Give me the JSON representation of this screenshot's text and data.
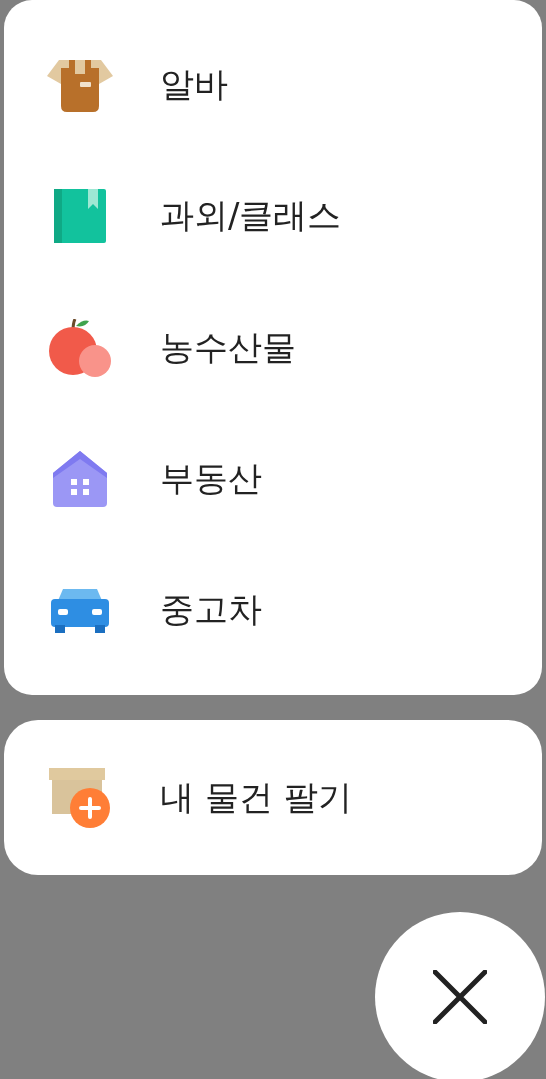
{
  "menu": {
    "items": [
      {
        "label": "알바"
      },
      {
        "label": "과외/클래스"
      },
      {
        "label": "농수산물"
      },
      {
        "label": "부동산"
      },
      {
        "label": "중고차"
      }
    ]
  },
  "sell": {
    "label": "내 물건 팔기"
  }
}
